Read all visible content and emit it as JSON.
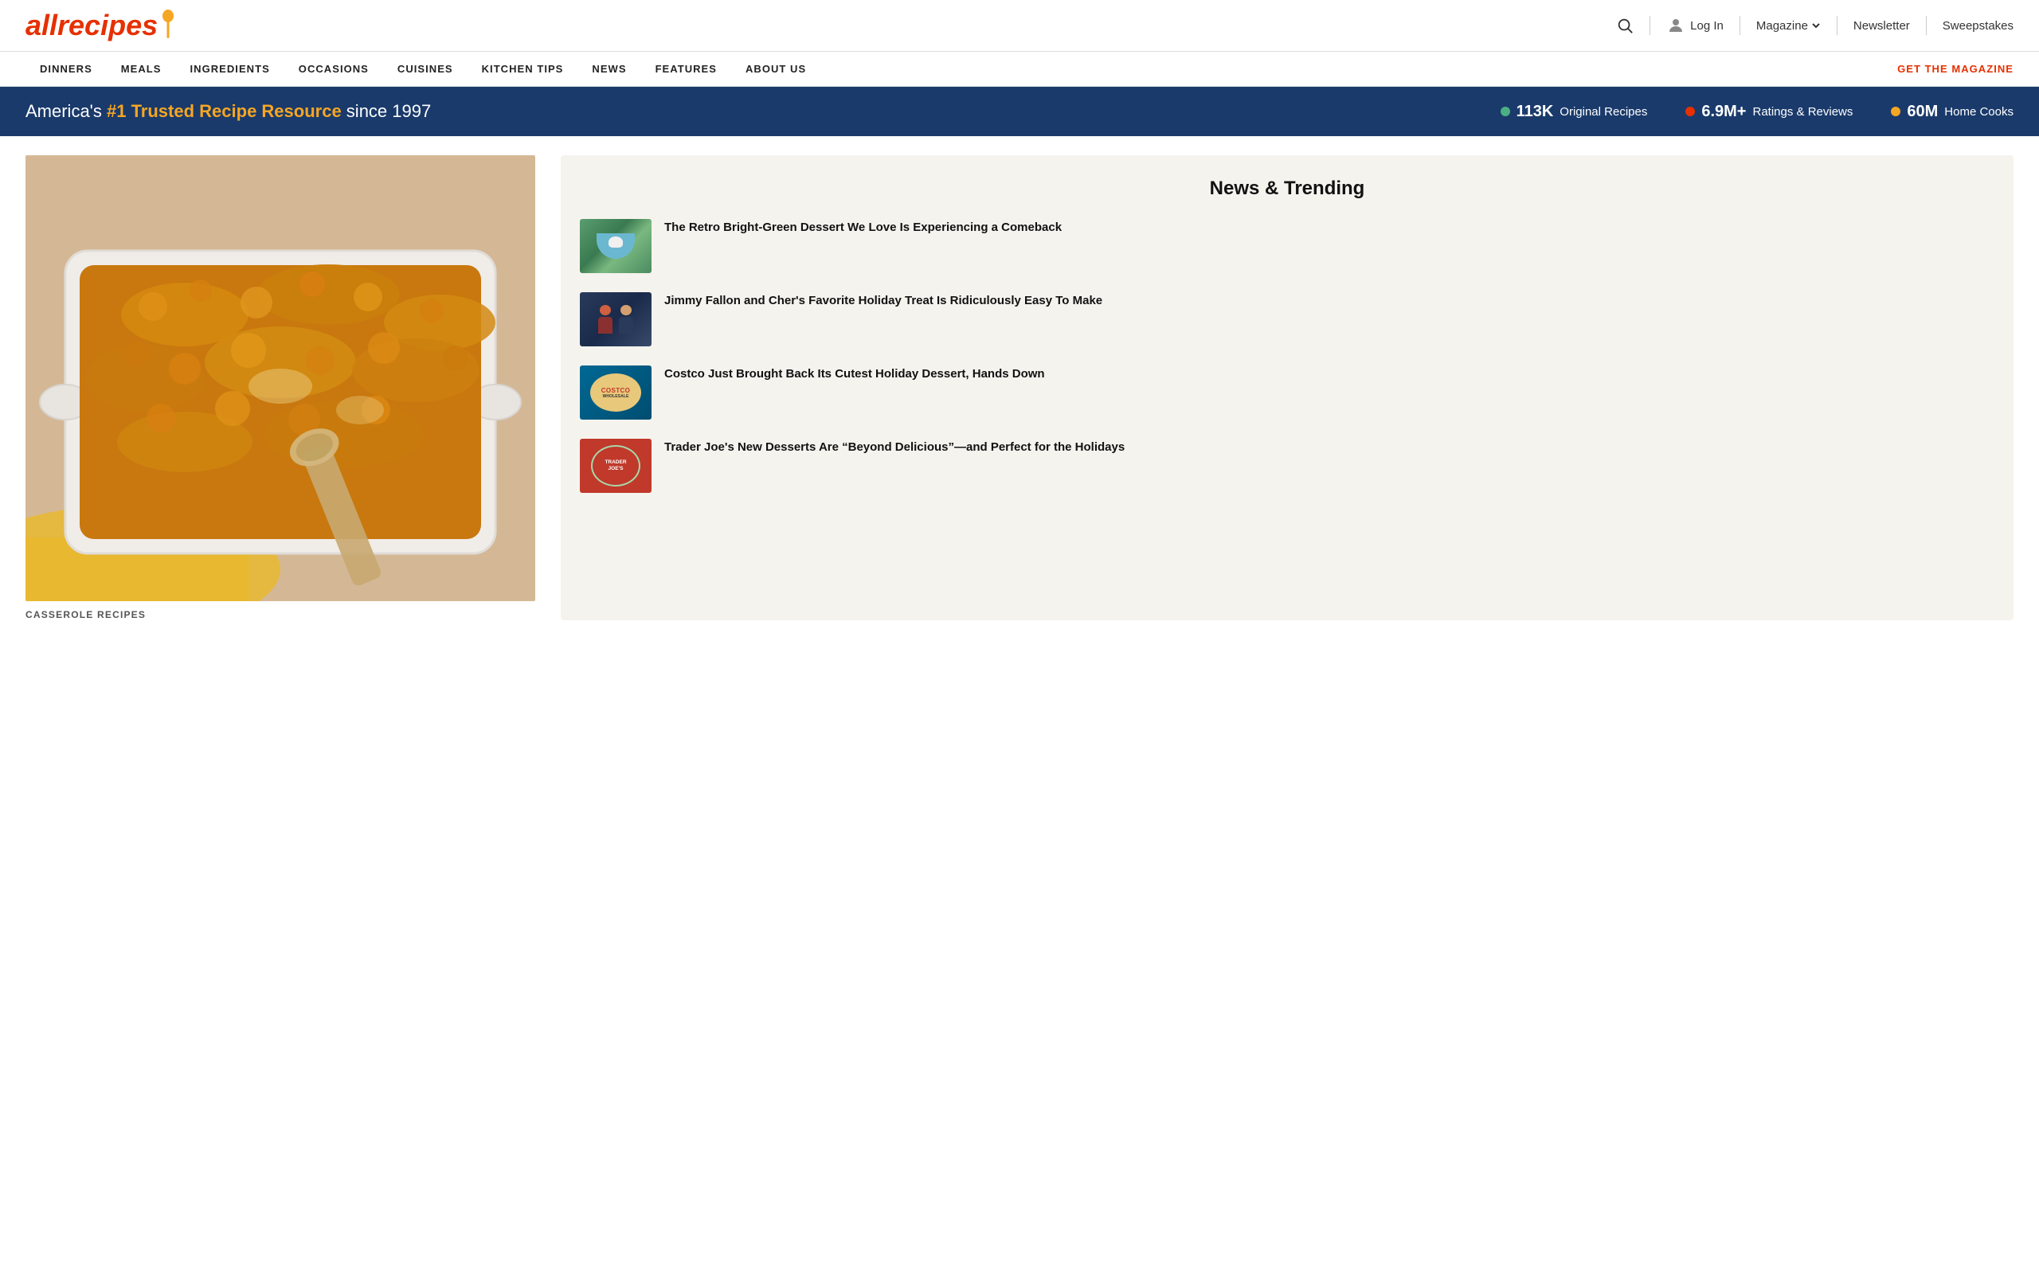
{
  "header": {
    "logo_text": "allrecipes",
    "login_label": "Log In",
    "magazine_label": "Magazine",
    "newsletter_label": "Newsletter",
    "sweepstakes_label": "Sweepstakes"
  },
  "nav": {
    "items": [
      {
        "label": "DINNERS"
      },
      {
        "label": "MEALS"
      },
      {
        "label": "INGREDIENTS"
      },
      {
        "label": "OCCASIONS"
      },
      {
        "label": "CUISINES"
      },
      {
        "label": "KITCHEN TIPS"
      },
      {
        "label": "NEWS"
      },
      {
        "label": "FEATURES"
      },
      {
        "label": "ABOUT US"
      }
    ],
    "cta_label": "GET THE MAGAZINE"
  },
  "banner": {
    "headline_prefix": "America's ",
    "headline_bold": "#1 Trusted Recipe Resource",
    "headline_suffix": " since 1997",
    "stats": [
      {
        "dot_color": "#4caf82",
        "number": "113K",
        "label": "Original Recipes"
      },
      {
        "dot_color": "#e63000",
        "number": "6.9M+",
        "label": "Ratings & Reviews"
      },
      {
        "dot_color": "#f5a623",
        "number": "60M",
        "label": "Home Cooks"
      }
    ]
  },
  "hero": {
    "label": "CASSEROLE RECIPES"
  },
  "sidebar": {
    "title": "News & Trending",
    "items": [
      {
        "id": 1,
        "thumb_type": "green-dessert",
        "headline": "The Retro Bright-Green Dessert We Love Is Experiencing a Comeback"
      },
      {
        "id": 2,
        "thumb_type": "fallon",
        "headline": "Jimmy Fallon and Cher's Favorite Holiday Treat Is Ridiculously Easy To Make"
      },
      {
        "id": 3,
        "thumb_type": "costco",
        "headline": "Costco Just Brought Back Its Cutest Holiday Dessert, Hands Down"
      },
      {
        "id": 4,
        "thumb_type": "traderjoes",
        "headline": "Trader Joe's New Desserts Are “Beyond Delicious”—and Perfect for the Holidays"
      }
    ]
  }
}
